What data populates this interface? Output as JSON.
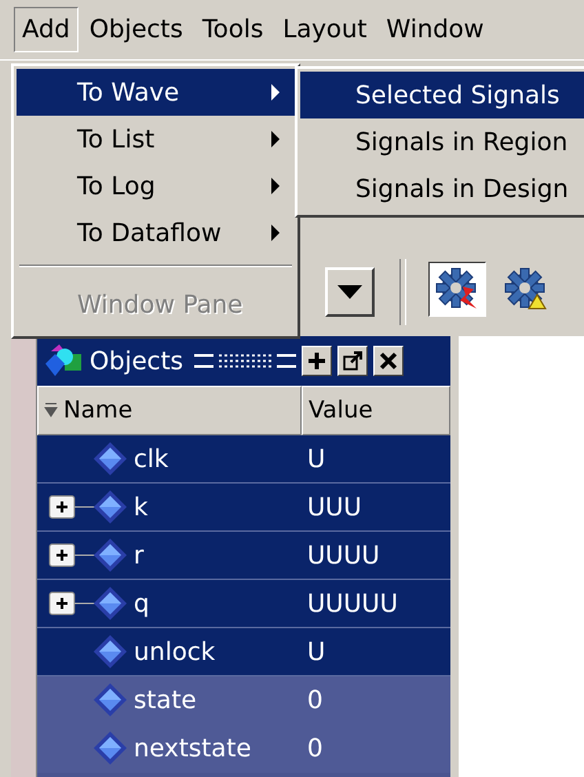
{
  "menu_bar": [
    {
      "label": "Add",
      "selected": true
    },
    {
      "label": "Objects",
      "selected": false
    },
    {
      "label": "Tools",
      "selected": false
    },
    {
      "label": "Layout",
      "selected": false
    },
    {
      "label": "Window",
      "selected": false
    }
  ],
  "add_menu": [
    {
      "label": "To Wave",
      "selected": true,
      "submenu": true,
      "disabled": false
    },
    {
      "label": "To List",
      "selected": false,
      "submenu": true,
      "disabled": false
    },
    {
      "label": "To Log",
      "selected": false,
      "submenu": true,
      "disabled": false
    },
    {
      "label": "To Dataflow",
      "selected": false,
      "submenu": true,
      "disabled": false
    },
    {
      "label": "Window Pane",
      "selected": false,
      "submenu": false,
      "disabled": true
    }
  ],
  "wave_submenu": [
    {
      "label": "Selected Signals",
      "selected": true
    },
    {
      "label": "Signals in Region",
      "selected": false
    },
    {
      "label": "Signals in Design",
      "selected": false
    }
  ],
  "objects_panel": {
    "title": "Objects",
    "columns": [
      "Name",
      "Value"
    ],
    "rows": [
      {
        "name": "clk",
        "value": "U",
        "expandable": false,
        "selected": true
      },
      {
        "name": "k",
        "value": "UUU",
        "expandable": true,
        "selected": true
      },
      {
        "name": "r",
        "value": "UUUU",
        "expandable": true,
        "selected": true
      },
      {
        "name": "q",
        "value": "UUUUU",
        "expandable": true,
        "selected": true
      },
      {
        "name": "unlock",
        "value": "U",
        "expandable": false,
        "selected": true
      },
      {
        "name": "state",
        "value": "0",
        "expandable": false,
        "selected": false
      },
      {
        "name": "nextstate",
        "value": "0",
        "expandable": false,
        "selected": false
      }
    ]
  }
}
